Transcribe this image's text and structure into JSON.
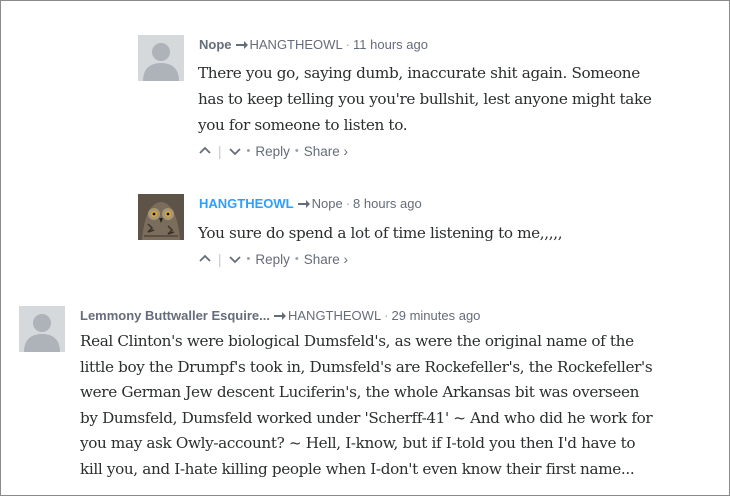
{
  "comments": [
    {
      "author": "Nope",
      "reply_to": "HANGTHEOWL",
      "time": "11 hours ago",
      "lines": [
        "There you go, saying dumb, inaccurate shit again. Someone",
        "has to keep telling you you're bullshit, lest anyone might take",
        "you for someone to listen to."
      ],
      "reply_label": "Reply",
      "share_label": "Share ›"
    },
    {
      "author": "HANGTHEOWL",
      "reply_to": "Nope",
      "time": "8 hours ago",
      "lines": [
        "You sure do spend a lot of time listening to me,,,,,"
      ],
      "reply_label": "Reply",
      "share_label": "Share ›"
    },
    {
      "author": "Lemmony Buttwaller Esquire...",
      "reply_to": "HANGTHEOWL",
      "time": "29 minutes ago",
      "lines": [
        "Real Clinton's were biological Dumsfeld's, as were the original name of the",
        "little boy the Drumpf's took in, Dumsfeld's are Rockefeller's, the Rockefeller's",
        "were German Jew descent Luciferin's, the whole Arkansas bit was overseen",
        "by Dumsfeld, Dumsfeld worked under 'Scherff-41' ~ And who did he work for",
        "you may ask Owly-account? ~ Hell, I-know, but if I-told you then I'd have to",
        "kill you, and I-hate killing people when I-don't even know their first name..."
      ]
    }
  ],
  "colors": {
    "author_link": "#2e9fff",
    "meta_gray": "#656c7a",
    "body_text": "#2a2e2e",
    "avatar_bg": "#d6d9dc"
  },
  "icons": [
    "default-avatar-icon",
    "owl-avatar-icon",
    "reply-arrow-icon",
    "upvote-icon",
    "downvote-icon"
  ]
}
